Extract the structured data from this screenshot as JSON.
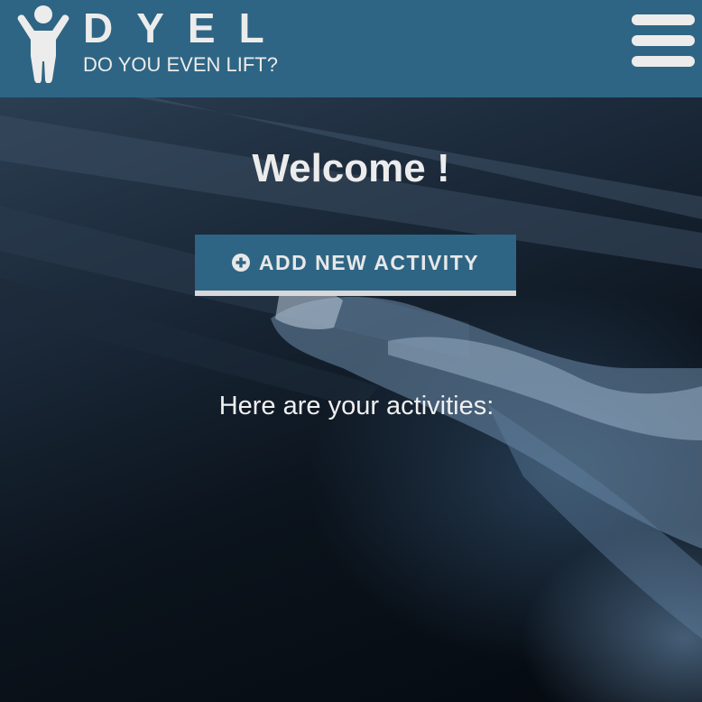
{
  "header": {
    "brand_title": "DYEL",
    "brand_subtitle": "DO YOU EVEN LIFT?",
    "logo_icon": "person-arms-up-icon",
    "menu_icon": "hamburger-menu-icon",
    "background_color": "#2e6584"
  },
  "main": {
    "welcome_text": "Welcome !",
    "add_button_label": "ADD NEW ACTIVITY",
    "add_button_icon": "plus-circle-icon",
    "activities_heading": "Here are your activities:"
  },
  "colors": {
    "accent": "#2e6584",
    "text": "#ececec",
    "button_underline": "#d8d8d8"
  }
}
